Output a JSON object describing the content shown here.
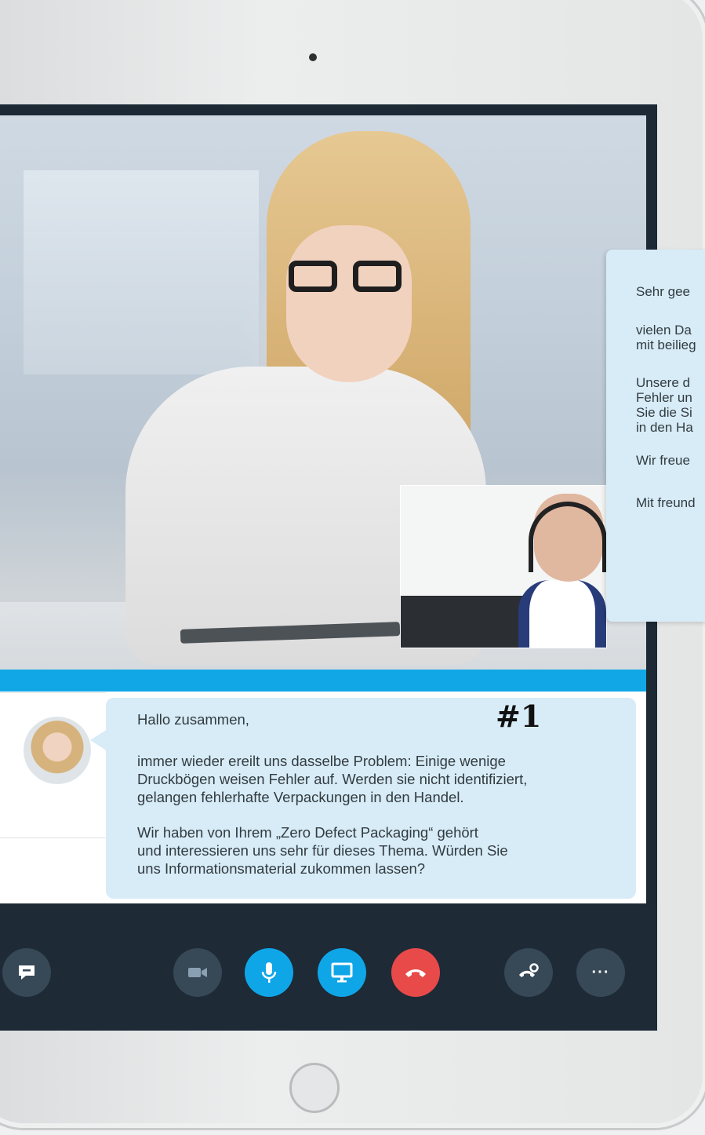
{
  "call": {
    "chat": {
      "message_lines": [
        "Hallo zusammen,",
        "immer wieder ereilt uns dasselbe Problem: Einige wenige",
        "Druckbögen weisen Fehler auf. Werden sie nicht identifiziert,",
        "gelangen fehlerhafte Verpackungen in den Handel.",
        "Wir haben von Ihrem „Zero Defect Packaging“ gehört",
        "und interessieren uns sehr für dieses Thema. Würden Sie",
        "uns Informationsmaterial zukommen lassen?"
      ]
    },
    "annotation": "#1",
    "email_reply": {
      "lines": [
        "Sehr gee",
        "vielen Da",
        "mit beilieg",
        "Unsere d",
        "Fehler un",
        "Sie die Si",
        "in den Ha",
        "Wir freue",
        "Mit freund"
      ]
    },
    "toolbar": {
      "chat_icon": "chat-bubble-icon",
      "video_icon": "video-camera-icon",
      "mic_icon": "microphone-icon",
      "screen_icon": "screen-share-icon",
      "hangup_icon": "hang-up-icon",
      "call_settings_icon": "phone-gear-icon",
      "more_label": "···"
    },
    "colors": {
      "accent_blue": "#0fa6e8",
      "hangup_red": "#e84a4a",
      "toolbar_dark": "#1e2a36",
      "bubble_bg": "#d7ecf7"
    }
  }
}
